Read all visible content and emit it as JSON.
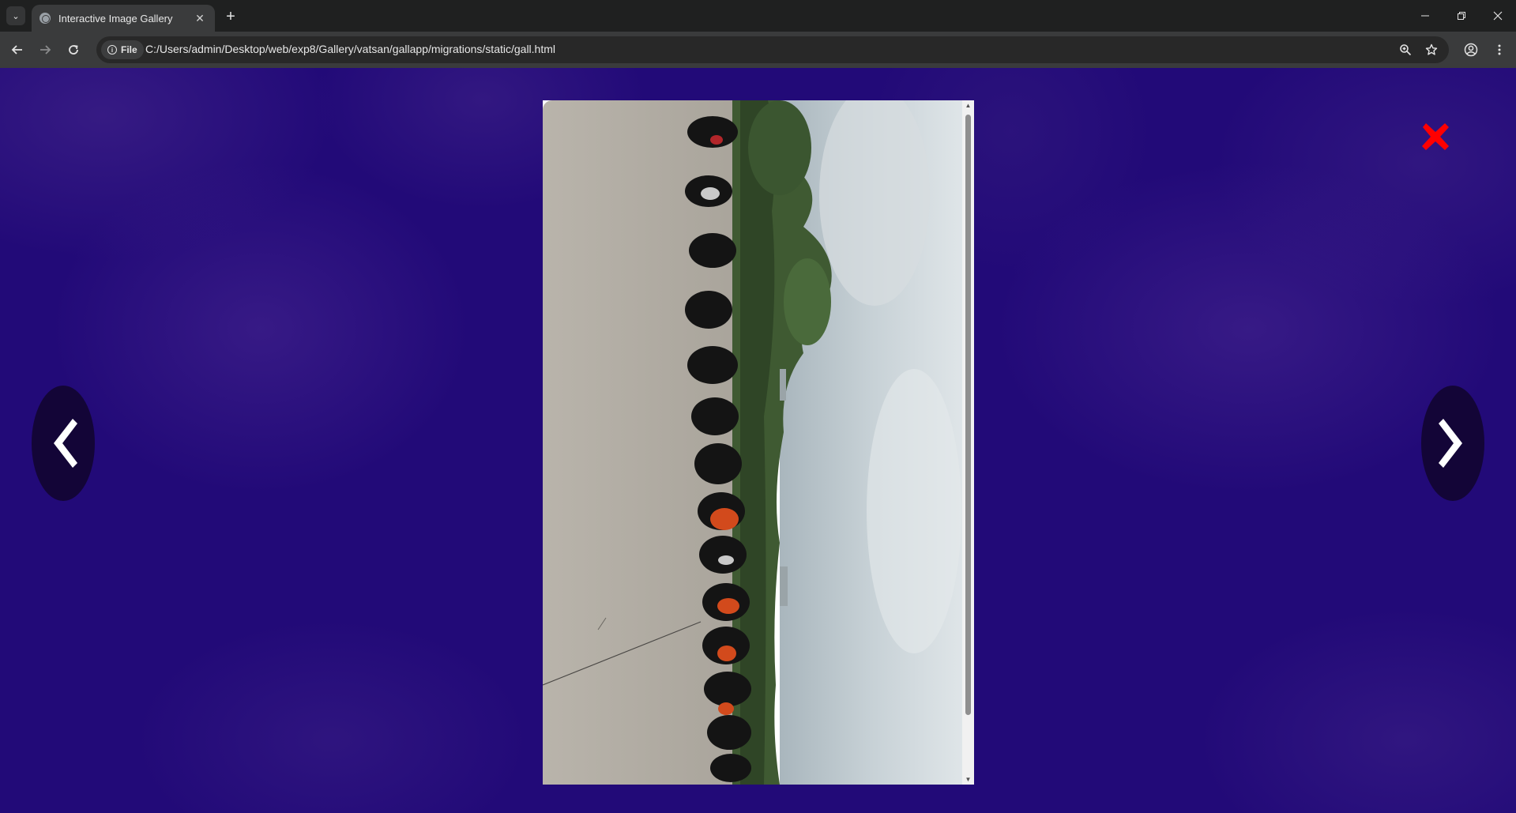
{
  "browser": {
    "tab_title": "Interactive Image Gallery",
    "url_chip": "File",
    "url": "C:/Users/admin/Desktop/web/exp8/Gallery/vatsan/gallapp/migrations/static/gall.html"
  },
  "gallery": {
    "prev_label": "❮",
    "next_label": "❯",
    "image_alt": "Row of parked motorcycles beside a concrete lot, photo rotated sideways",
    "colors": {
      "background": "#220a78",
      "nav_button": "#130537",
      "close_icon": "#ff0000"
    }
  }
}
